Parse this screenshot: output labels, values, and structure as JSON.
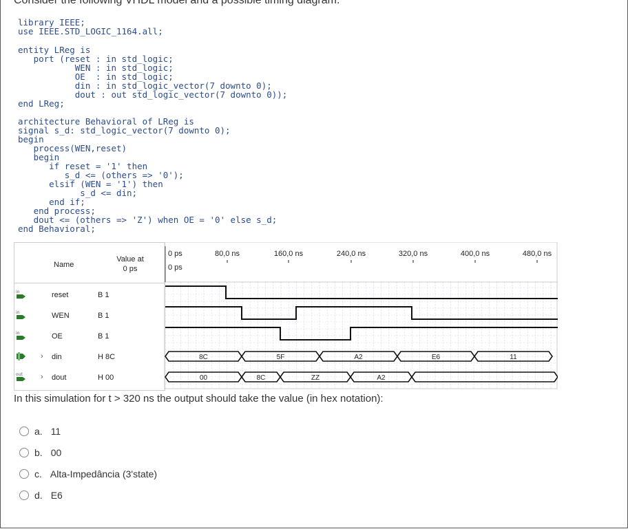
{
  "header": "Consider the following VHDL model and a possible timing diagram.",
  "code_lines": [
    "library IEEE;",
    "use IEEE.STD_LOGIC_1164.all;",
    "",
    "entity LReg is",
    "   port (reset : in std_logic;",
    "           WEN : in std_logic;",
    "           OE  : in std_logic;",
    "           din : in std_logic_vector(7 downto 0);",
    "           dout : out std_logic_vector(7 downto 0));",
    "end LReg;",
    "",
    "architecture Behavioral of LReg is",
    "signal s_d: std_logic_vector(7 downto 0);",
    "begin",
    "   process(WEN,reset)",
    "   begin",
    "      if reset = '1' then",
    "         s_d <= (others => '0');",
    "      elsif (WEN = '1') then",
    "            s_d <= din;",
    "      end if;",
    "   end process;",
    "   dout <= (others => 'Z') when OE = '0' else s_d;",
    "end Behavioral;"
  ],
  "sim": {
    "col_name": "Name",
    "col_value_line1": "Value at",
    "col_value_line2": "0 ps",
    "cursor_label": "0 ps",
    "time_labels": [
      "0 ps",
      "80,0 ns",
      "160,0 ns",
      "240,0 ns",
      "320,0 ns",
      "400,0 ns",
      "480,0 ns"
    ],
    "rows": [
      {
        "icon": "input-pin-icon",
        "name": "reset",
        "value": "B 1"
      },
      {
        "icon": "input-pin-icon",
        "name": "WEN",
        "value": "B 1"
      },
      {
        "icon": "input-pin-icon",
        "name": "OE",
        "value": "B 1"
      },
      {
        "icon": "input-bus-icon",
        "name": "din",
        "value": "H 8C"
      },
      {
        "icon": "output-bus-icon",
        "name": "dout",
        "value": "H 00"
      }
    ],
    "din_values": [
      "8C",
      "5F",
      "A2",
      "E6",
      "11"
    ],
    "dout_values": [
      "00",
      "8C",
      "ZZ",
      "A2"
    ]
  },
  "question": "In this simulation for t > 320 ns the output should take the value (in hex notation):",
  "options": [
    {
      "letter": "a.",
      "text": "11"
    },
    {
      "letter": "b.",
      "text": "00"
    },
    {
      "letter": "c.",
      "text": "Alta-Impedância (3'state)"
    },
    {
      "letter": "d.",
      "text": "E6"
    }
  ],
  "colors": {
    "code": "#2b4c8c",
    "wave": "#111111",
    "grid": "#cfd6e2"
  }
}
